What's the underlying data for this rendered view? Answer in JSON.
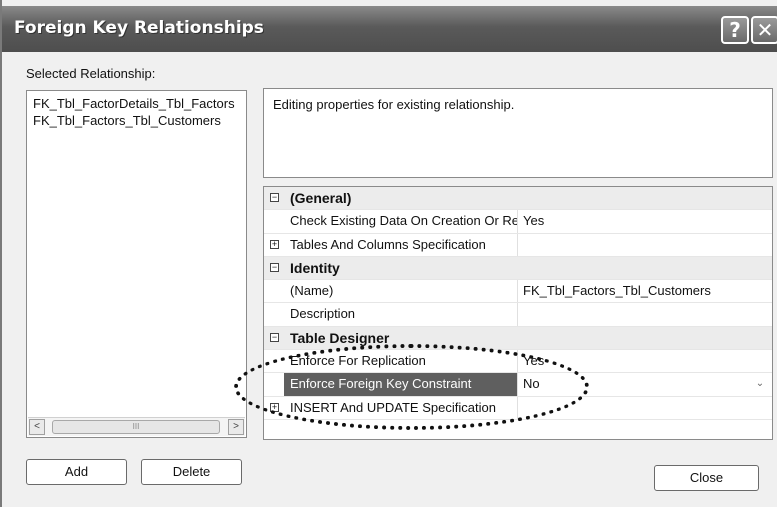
{
  "window": {
    "title": "Foreign Key Relationships",
    "help_glyph": "?",
    "close_glyph": "✕"
  },
  "relationships": {
    "label": "Selected Relationship:",
    "items": [
      "FK_Tbl_FactorDetails_Tbl_Factors",
      "FK_Tbl_Factors_Tbl_Customers"
    ],
    "scroll_left": "<",
    "scroll_right": ">",
    "scroll_grip": "III"
  },
  "description": "Editing properties for existing relationship.",
  "properties": {
    "categories": [
      {
        "name": "(General)",
        "toggle": "−",
        "rows": [
          {
            "name": "Check Existing Data On Creation Or Re-Enabling",
            "value": "Yes",
            "toggle": ""
          },
          {
            "name": "Tables And Columns Specification",
            "value": "",
            "toggle": "+"
          }
        ]
      },
      {
        "name": "Identity",
        "toggle": "−",
        "rows": [
          {
            "name": "(Name)",
            "value": "FK_Tbl_Factors_Tbl_Customers",
            "toggle": ""
          },
          {
            "name": "Description",
            "value": "",
            "toggle": ""
          }
        ]
      },
      {
        "name": "Table Designer",
        "toggle": "−",
        "rows": [
          {
            "name": "Enforce For Replication",
            "value": "Yes",
            "toggle": ""
          },
          {
            "name": "Enforce Foreign Key Constraint",
            "value": "No",
            "toggle": ""
          },
          {
            "name": "INSERT And UPDATE Specification",
            "value": "",
            "toggle": "+"
          }
        ]
      }
    ],
    "dropdown_glyph": "⌄"
  },
  "buttons": {
    "add": "Add",
    "delete": "Delete",
    "close": "Close"
  }
}
